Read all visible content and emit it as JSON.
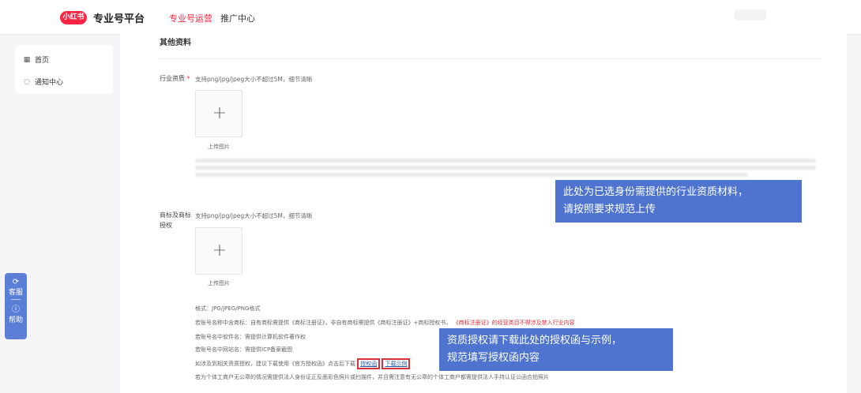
{
  "header": {
    "logo_text": "小红书",
    "brand_title": "专业号平台",
    "tabs": [
      {
        "label": "专业号运营",
        "active": true
      },
      {
        "label": "推广中心",
        "active": false
      }
    ]
  },
  "sidebar": {
    "items": [
      {
        "icon": "grid-icon",
        "label": "首页"
      },
      {
        "icon": "bell-icon",
        "label": "通知中心"
      }
    ]
  },
  "float_help": {
    "service_label": "客服",
    "help_label": "帮助"
  },
  "main": {
    "section_title": "其他资料",
    "industry": {
      "label": "行业资质",
      "required_mark": "*",
      "hint": "支持png/jpg/jpeg大小不超过5M，细节清晰",
      "upload_label": "上传图片"
    },
    "trademark": {
      "label": "商标及商标授权",
      "hint": "支持png/jpg/jpeg大小不超过5M，细节清晰",
      "upload_label": "上传图片",
      "notes": {
        "format": "格式：JPG/JPEG/PNG格式",
        "trademark_prefix": "若账号名称中含商标：自有商标需提供《商标注册证》，非自有商标需提供《商标注册证》+商标授权书。",
        "trademark_red": "《商标注册证》的经营类目不得涉及禁入行业内容",
        "software": "若账号名中软件名：需提供计算机软件著作权",
        "website": "若账号名中网站名：需提供ICP备案截图",
        "auth_prefix": "如涉及到相关资质授权，建议下载使用《官方授权函》点击后下载",
        "auth_link": "授权函",
        "sample_link": "下载示例",
        "individual": "若为个体工商户无公章的情况需提供法人身份证正反面彩色照片或扫描件，并且需注意有无公章的个体工商户都需提供法人手持认证公函合拍照片"
      }
    }
  },
  "callouts": {
    "industry": [
      "此处为已选身份需提供的行业资质材料，",
      "请按照要求规范上传"
    ],
    "auth": [
      "资质授权请下载此处的授权函与示例，",
      "规范填写授权函内容"
    ]
  },
  "colors": {
    "brand": "#ff2442",
    "callout": "#4e74d0",
    "float": "#5b7fd6"
  }
}
